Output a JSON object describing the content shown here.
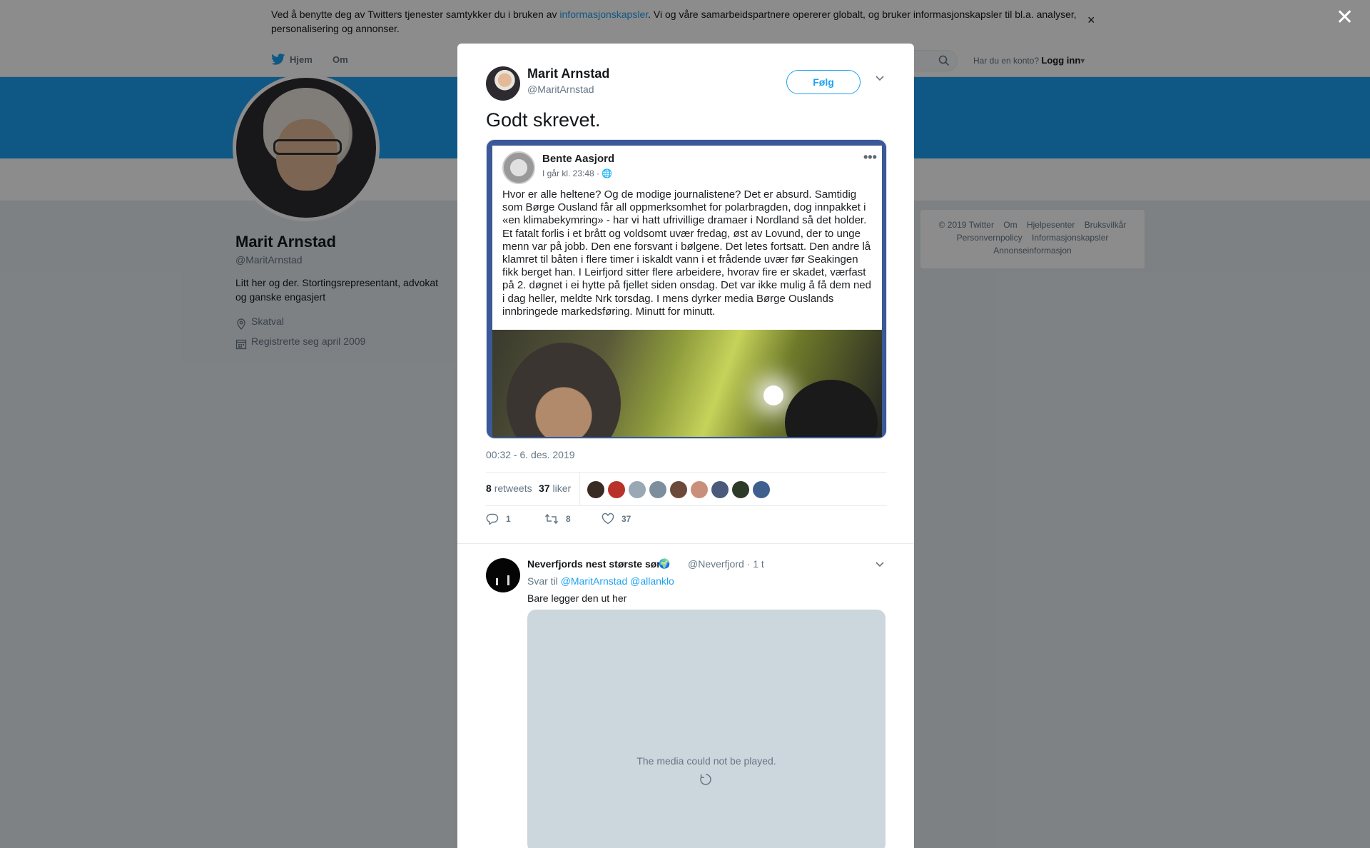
{
  "cookie_banner": {
    "text_before": "Ved å benytte deg av Twitters tjenester samtykker du i bruken av ",
    "link": "informasjonskapsler",
    "text_after": ". Vi og våre samarbeidspartnere opererer globalt, og bruker informasjonskapsler til bl.a. analyser, personalisering og annonser.",
    "close": "×"
  },
  "nav": {
    "home": "Hjem",
    "about": "Om",
    "account_prompt": "Har du en konto?",
    "login": "Logg inn",
    "login_caret": "▾"
  },
  "profile": {
    "name": "Marit Arnstad",
    "handle": "@MaritArnstad",
    "bio": "Litt her og der. Stortingsrepresentant, advokat og ganske engasjert",
    "location": "Skatval",
    "joined": "Registrerte seg april 2009"
  },
  "footer": {
    "links_row1": [
      "© 2019 Twitter",
      "Om",
      "Hjelpesenter",
      "Bruksvilkår"
    ],
    "links_row2": [
      "Personvernpolicy",
      "Informasjonskapsler"
    ],
    "links_row3": [
      "Annonseinformasjon"
    ]
  },
  "overlay_close": "✕",
  "tweet": {
    "author_name": "Marit Arnstad",
    "author_handle": "@MaritArnstad",
    "follow_label": "Følg",
    "text": "Godt skrevet.",
    "screenshot": {
      "fb_name": "Bente Aasjord",
      "fb_time": "I går kl. 23:48 · 🌐",
      "fb_more": "•••",
      "fb_text": "Hvor er alle heltene? Og de modige journalistene? Det er absurd. Samtidig som Børge Ousland får all oppmerksomhet for polarbragden, dog innpakket i «en klimabekymring» - har vi hatt ufrivillige dramaer i Nordland så det holder. Et fatalt forlis i et brått og voldsomt uvær fredag, øst av Lovund, der to unge menn var på jobb. Den ene forsvant i bølgene. Det letes fortsatt. Den andre lå klamret til båten i flere timer i iskaldt vann i et frådende uvær før Seakingen fikk berget han. I Leirfjord sitter flere arbeidere, hvorav fire er skadet, værfast på 2. døgnet i ei hytte på fjellet siden onsdag. Det var ikke mulig å få dem ned i dag heller, meldte Nrk torsdag. I mens dyrker media Børge Ouslands innbringede markedsføring. Minutt for minutt."
    },
    "date": "00:32 - 6. des. 2019",
    "retweets_count": "8",
    "retweets_label": "retweets",
    "likes_count": "37",
    "likes_label": "liker",
    "liker_colors": [
      "#3a2a24",
      "#b8322a",
      "#9aa8b4",
      "#7d8e9c",
      "#6b4a3a",
      "#c98f7a",
      "#4a5a7a",
      "#2e3a28",
      "#3f5f8f"
    ],
    "actions": {
      "reply_count": "1",
      "retweet_count": "8",
      "like_count": "37"
    }
  },
  "reply": {
    "author_name": "Neverfjords nest største sønn",
    "globe": "🌍",
    "author_handle": "@Neverfjord · 1 t",
    "reply_prefix": "Svar til",
    "reply_to": "@MaritArnstad @allanklo",
    "text": "Bare legger den ut her",
    "media_error": "The media could not be played."
  }
}
